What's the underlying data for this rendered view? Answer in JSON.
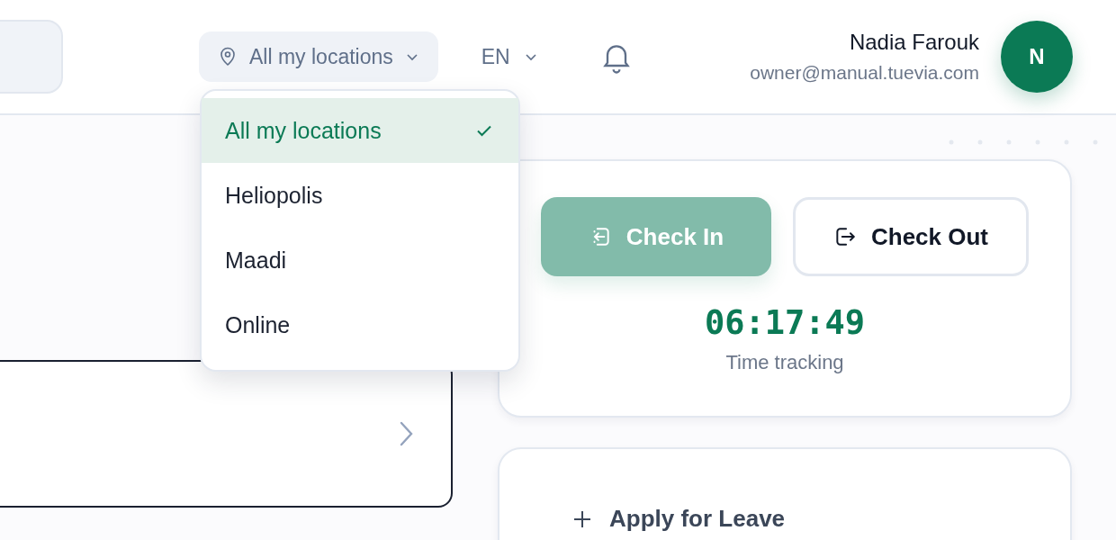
{
  "header": {
    "location_selector": {
      "label": "All my locations",
      "expanded": true
    },
    "language": "EN",
    "user": {
      "name": "Nadia Farouk",
      "email": "owner@manual.tuevia.com",
      "avatar_initial": "N"
    }
  },
  "location_menu": [
    {
      "label": "All my locations",
      "selected": true
    },
    {
      "label": "Heliopolis",
      "selected": false
    },
    {
      "label": "Maadi",
      "selected": false
    },
    {
      "label": "Online",
      "selected": false
    }
  ],
  "attendance": {
    "buttons": [
      {
        "label": "Check In",
        "kind": "in",
        "disabled": true
      },
      {
        "label": "Check Out",
        "kind": "out",
        "disabled": false
      }
    ],
    "timer": "06:17:49",
    "timer_label": "Time tracking"
  },
  "leave": {
    "label": "Apply for Leave"
  }
}
